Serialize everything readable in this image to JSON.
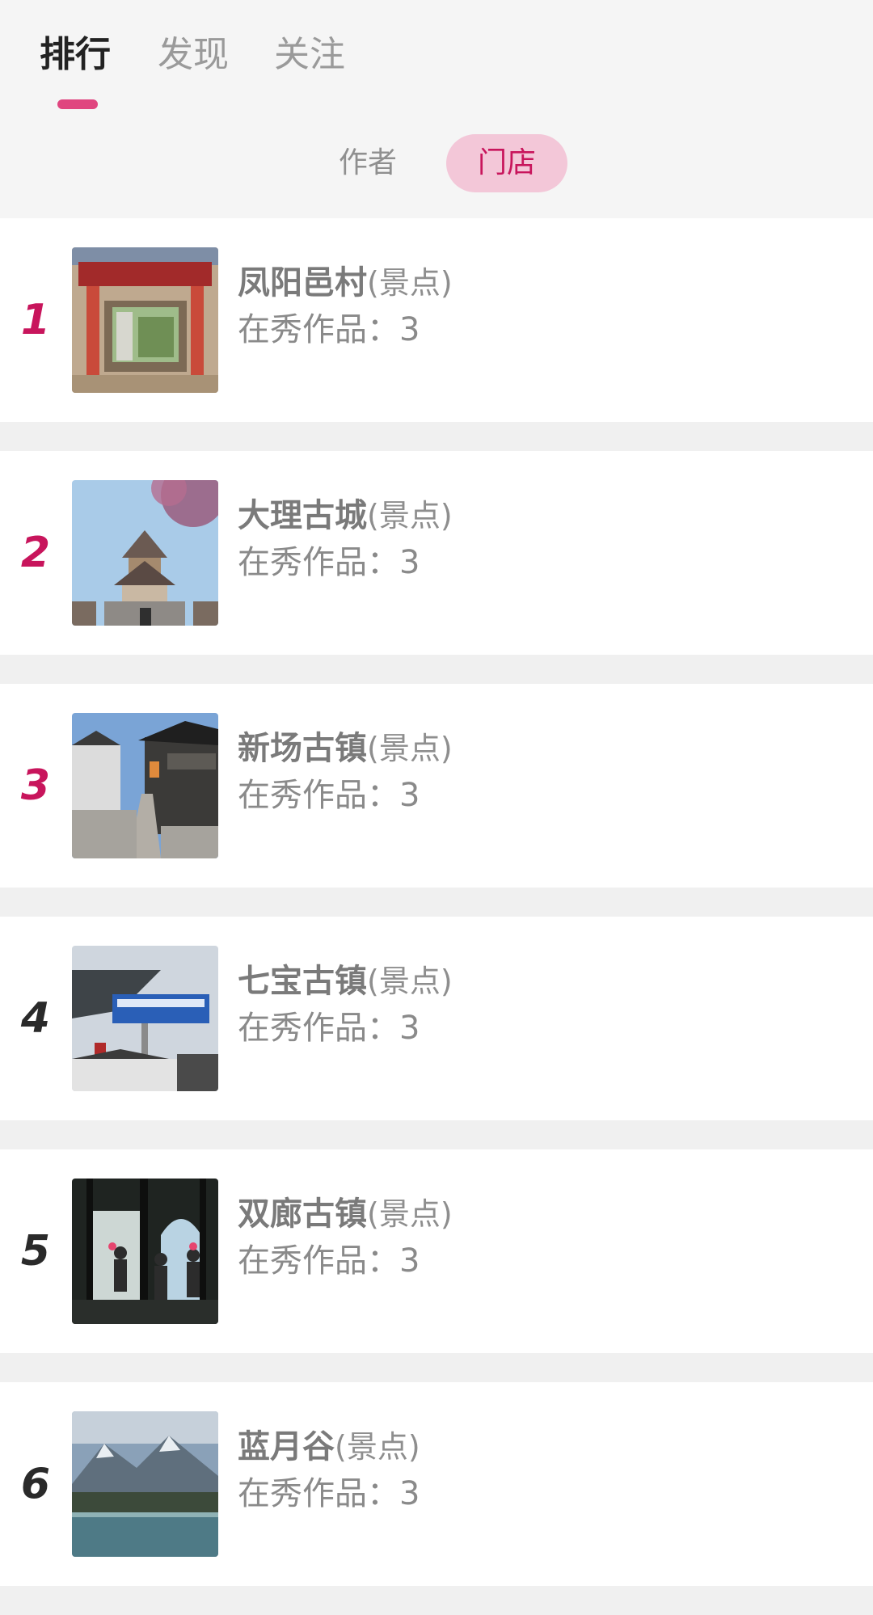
{
  "tabs": [
    {
      "label": "排行",
      "active": true
    },
    {
      "label": "发现",
      "active": false
    },
    {
      "label": "关注",
      "active": false
    }
  ],
  "sub_tabs": [
    {
      "label": "作者",
      "active": false
    },
    {
      "label": "门店",
      "active": true
    }
  ],
  "colors": {
    "accent": "#c8155c",
    "indicator": "#e0457f",
    "selected_pill": "#f3c7d8"
  },
  "ranking": [
    {
      "rank": "1",
      "name": "凤阳邑村",
      "type": "(景点)",
      "works_label": "在秀作品：",
      "works": "3",
      "thumbnail": "village-gate-photo"
    },
    {
      "rank": "2",
      "name": "大理古城",
      "type": "(景点)",
      "works_label": "在秀作品：",
      "works": "3",
      "thumbnail": "ancient-tower-blossom-photo"
    },
    {
      "rank": "3",
      "name": "新场古镇",
      "type": "(景点)",
      "works_label": "在秀作品：",
      "works": "3",
      "thumbnail": "water-town-street-photo"
    },
    {
      "rank": "4",
      "name": "七宝古镇",
      "type": "(景点)",
      "works_label": "在秀作品：",
      "works": "3",
      "thumbnail": "street-sign-eaves-photo"
    },
    {
      "rank": "5",
      "name": "双廊古镇",
      "type": "(景点)",
      "works_label": "在秀作品：",
      "works": "3",
      "thumbnail": "arched-window-people-photo"
    },
    {
      "rank": "6",
      "name": "蓝月谷",
      "type": "(景点)",
      "works_label": "在秀作品：",
      "works": "3",
      "thumbnail": "snow-mountain-lake-photo"
    }
  ]
}
